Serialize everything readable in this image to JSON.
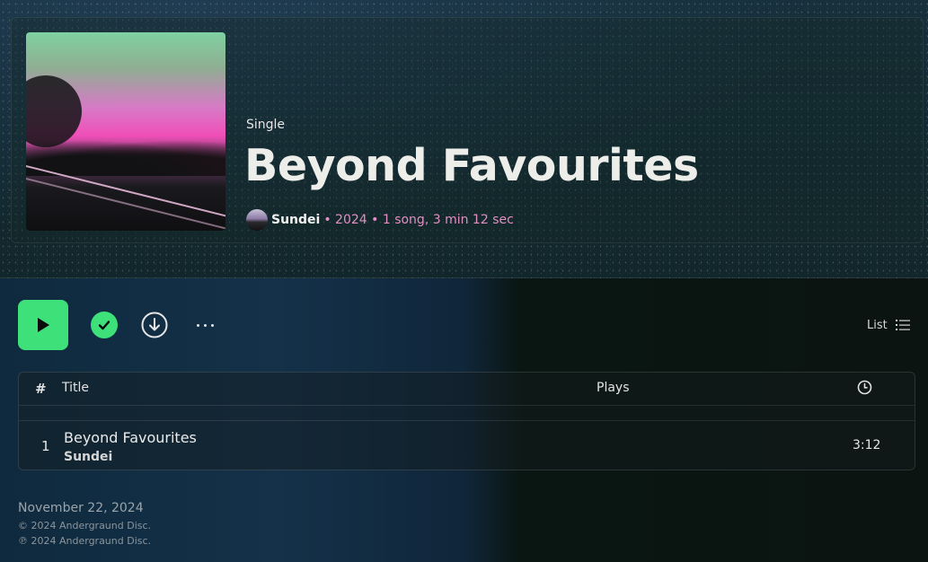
{
  "album": {
    "type_label": "Single",
    "title": "Beyond Favourites",
    "artist": "Sundei",
    "meta": "• 2024 • 1 song, 3 min 12 sec"
  },
  "controls": {
    "play_icon": "play-icon",
    "saved_icon": "check-circle-icon",
    "download_icon": "download-icon",
    "more_icon": "more-horizontal-icon",
    "view_label": "List",
    "view_icon": "list-icon"
  },
  "table": {
    "header": {
      "num": "#",
      "title": "Title",
      "plays": "Plays",
      "duration_icon": "clock-icon"
    },
    "tracks": [
      {
        "num": "1",
        "title": "Beyond Favourites",
        "artist": "Sundei",
        "duration": "3:12"
      }
    ]
  },
  "footer": {
    "release_date": "November 22, 2024",
    "copyright": "© 2024 Andergraund Disc.",
    "phonographic": "℗ 2024 Andergraund Disc."
  },
  "colors": {
    "accent": "#3ee07a",
    "meta_pink": "#e38fc4"
  }
}
